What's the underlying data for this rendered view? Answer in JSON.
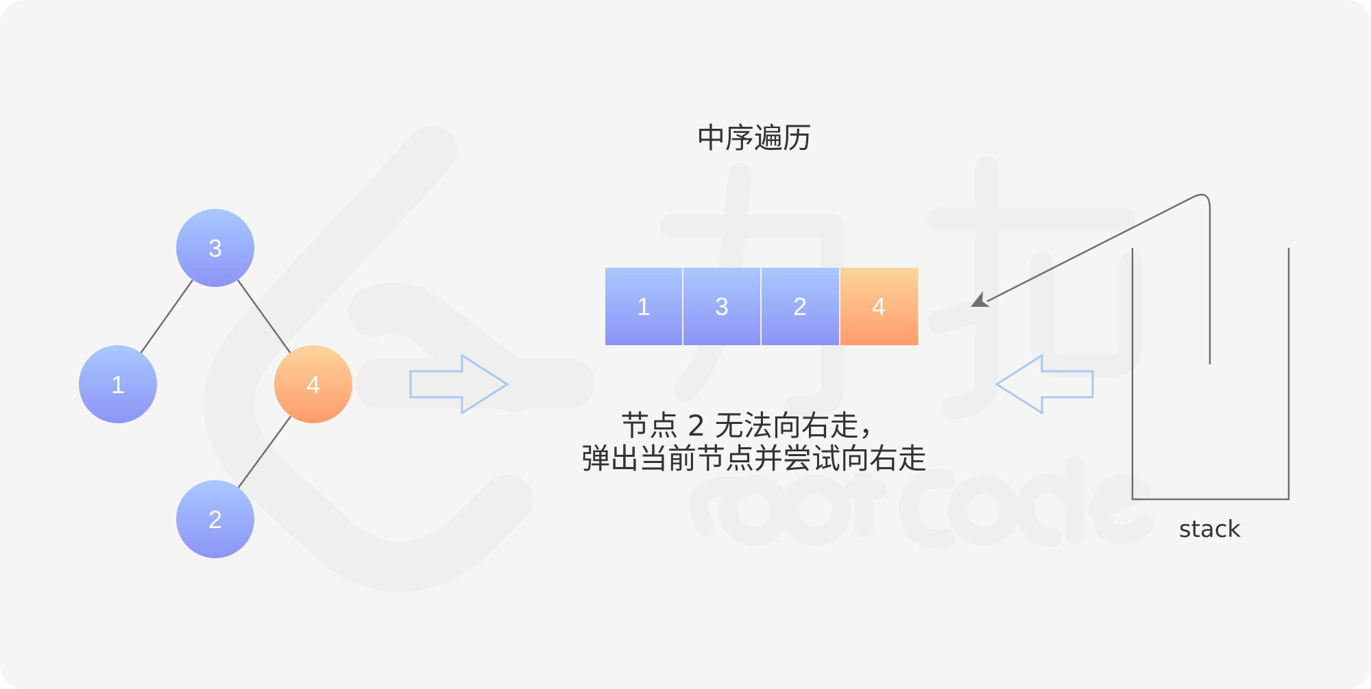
{
  "title": "中序遍历",
  "tree": {
    "nodes": [
      {
        "id": "node-3",
        "label": "3",
        "state": "visited"
      },
      {
        "id": "node-1",
        "label": "1",
        "state": "visited"
      },
      {
        "id": "node-4",
        "label": "4",
        "state": "current"
      },
      {
        "id": "node-2",
        "label": "2",
        "state": "visited"
      }
    ],
    "edges": [
      [
        "3",
        "1"
      ],
      [
        "3",
        "4"
      ],
      [
        "4",
        "2"
      ]
    ]
  },
  "sequence": [
    {
      "label": "1",
      "state": "visited"
    },
    {
      "label": "3",
      "state": "visited"
    },
    {
      "label": "2",
      "state": "visited"
    },
    {
      "label": "4",
      "state": "current"
    }
  ],
  "caption": {
    "line1": "节点 2 无法向右走，",
    "line2": "弹出当前节点并尝试向右走"
  },
  "stack": {
    "label": "stack"
  },
  "colors": {
    "visited_top": "#a9c8ff",
    "visited_bottom": "#8c94f6",
    "current_top": "#fdd49c",
    "current_bottom": "#fe9c6b",
    "arrow_outline": "#a9c8f5",
    "line": "#707070",
    "background": "#f5f5f5"
  }
}
